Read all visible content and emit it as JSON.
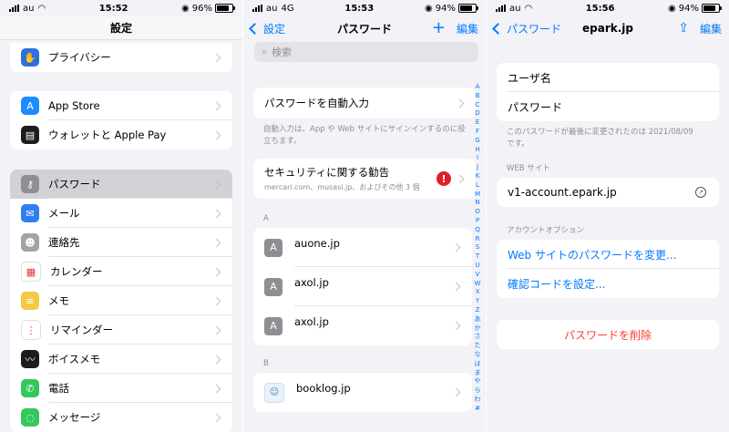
{
  "colors": {
    "accent": "#007aff",
    "alert": "#e01e2a",
    "background": "#f2f2f7"
  },
  "panel1": {
    "status": {
      "carrier": "au",
      "time": "15:52",
      "battery": "96%",
      "battery_level": 0.96
    },
    "title": "設定",
    "items": [
      {
        "label": "プライバシー",
        "icon": "hand-icon",
        "color": "#2f6fe0",
        "glyph": "✋"
      },
      {
        "label": "App Store",
        "icon": "app-store-icon",
        "color": "#1a8cff",
        "glyph": "A"
      },
      {
        "label": "ウォレットと Apple Pay",
        "icon": "wallet-icon",
        "color": "#1c1c1e",
        "glyph": "▤"
      },
      {
        "label": "パスワード",
        "icon": "key-icon",
        "color": "#8e8e93",
        "glyph": "⚷"
      },
      {
        "label": "メール",
        "icon": "mail-icon",
        "color": "#2f7fef",
        "glyph": "✉"
      },
      {
        "label": "連絡先",
        "icon": "contacts-icon",
        "color": "#a2a2a7",
        "glyph": "☻"
      },
      {
        "label": "カレンダー",
        "icon": "calendar-icon",
        "color": "#ffffff",
        "glyph": "▦"
      },
      {
        "label": "メモ",
        "icon": "notes-icon",
        "color": "#f6c945",
        "glyph": "≡"
      },
      {
        "label": "リマインダー",
        "icon": "reminders-icon",
        "color": "#ffffff",
        "glyph": "⋮"
      },
      {
        "label": "ボイスメモ",
        "icon": "voice-memos-icon",
        "color": "#1c1c1e",
        "glyph": "〰"
      },
      {
        "label": "電話",
        "icon": "phone-icon",
        "color": "#34c759",
        "glyph": "✆"
      },
      {
        "label": "メッセージ",
        "icon": "messages-icon",
        "color": "#34c759",
        "glyph": "◌"
      }
    ]
  },
  "panel2": {
    "status": {
      "carrier": "au",
      "network": "4G",
      "time": "15:53",
      "battery": "94%",
      "battery_level": 0.94
    },
    "back": "設定",
    "title": "パスワード",
    "add": "+",
    "edit": "編集",
    "search_placeholder": "検索",
    "autofill": "パスワードを自動入力",
    "autofill_note": "自動入力は、App や Web サイトにサインインするのに役立ちます。",
    "security": {
      "title": "セキュリティに関する勧告",
      "subtitle": "mercari.com、musasi.jp、およびその他 3 個",
      "badge": "!"
    },
    "sections": [
      {
        "letter": "A",
        "items": [
          {
            "name": "auone.jp",
            "badge": "A"
          },
          {
            "name": "axol.jp",
            "badge": "A"
          },
          {
            "name": "axol.jp",
            "badge": "A"
          }
        ]
      },
      {
        "letter": "B",
        "items": [
          {
            "name": "booklog.jp",
            "badge": ""
          }
        ]
      }
    ],
    "index": [
      "A",
      "B",
      "C",
      "D",
      "E",
      "F",
      "G",
      "H",
      "I",
      "J",
      "K",
      "L",
      "M",
      "N",
      "O",
      "P",
      "Q",
      "R",
      "S",
      "T",
      "U",
      "V",
      "W",
      "X",
      "Y",
      "Z",
      "あ",
      "か",
      "さ",
      "た",
      "な",
      "は",
      "ま",
      "や",
      "ら",
      "わ",
      "#"
    ]
  },
  "panel3": {
    "status": {
      "carrier": "au",
      "time": "15:56",
      "battery": "94%",
      "battery_level": 0.94
    },
    "back": "パスワード",
    "title": "epark.jp",
    "edit": "編集",
    "username_label": "ユーザ名",
    "password_label": "パスワード",
    "changed_note": "このパスワードが最後に変更されたのは 2021/08/09 です。",
    "website_header": "WEB サイト",
    "website": "v1-account.epark.jp",
    "account_header": "アカウントオプション",
    "change_password": "Web サイトのパスワードを変更...",
    "setup_code": "確認コードを設定...",
    "delete": "パスワードを削除"
  }
}
